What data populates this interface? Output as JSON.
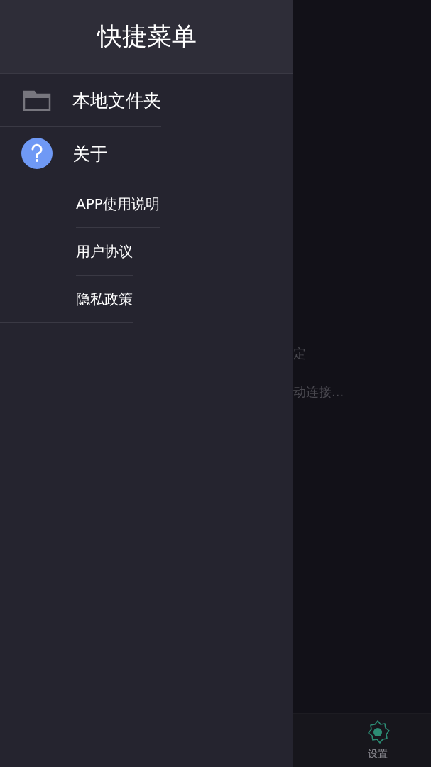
{
  "background": {
    "texts": [
      "定",
      "动连接..."
    ]
  },
  "bottom_nav": [
    {
      "label": "设置",
      "selected": true
    }
  ],
  "drawer": {
    "title": "快捷菜单",
    "items": [
      {
        "kind": "folder",
        "label": "本地文件夹"
      },
      {
        "kind": "help",
        "label": "关于",
        "children": [
          {
            "label": "APP使用说明"
          },
          {
            "label": "用户协议"
          },
          {
            "label": "隐私政策"
          }
        ]
      }
    ]
  }
}
